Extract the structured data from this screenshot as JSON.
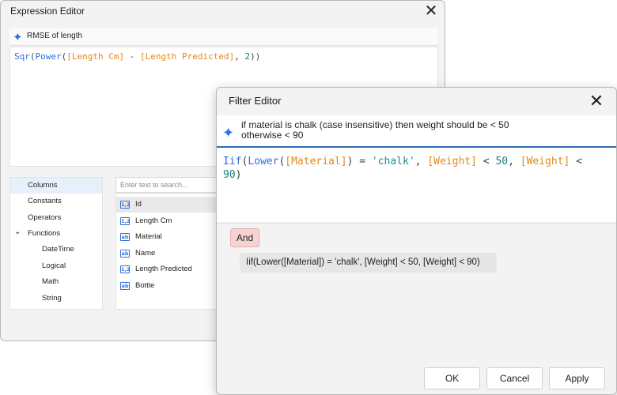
{
  "expression_editor": {
    "title": "Expression Editor",
    "close_glyph": "✕",
    "ai_prompt": "RMSE of length",
    "code": {
      "fn1": "Sqr",
      "fn2": "Power",
      "field1": "[Length Cm]",
      "minus": " - ",
      "field2": "[Length Predicted]",
      "comma": ", ",
      "num": "2",
      "open": "(",
      "close": "))"
    },
    "categories": [
      {
        "label": "Columns",
        "selected": true
      },
      {
        "label": "Constants"
      },
      {
        "label": "Operators"
      },
      {
        "label": "Functions",
        "expander": "⌄"
      },
      {
        "label": "DateTime"
      },
      {
        "label": "Logical"
      },
      {
        "label": "Math"
      },
      {
        "label": "String"
      }
    ],
    "search_placeholder": "Enter text to search...",
    "fields": [
      {
        "label": "Id",
        "icon": "1,2",
        "selected": true
      },
      {
        "label": "Length Cm",
        "icon": "1,2"
      },
      {
        "label": "Material",
        "icon": "ab"
      },
      {
        "label": "Name",
        "icon": "ab"
      },
      {
        "label": "Length Predicted",
        "icon": "1,2"
      },
      {
        "label": "Bottle",
        "icon": "ab"
      }
    ]
  },
  "filter_editor": {
    "title": "Filter Editor",
    "close_glyph": "✕",
    "ai_prompt": "if material is chalk (case insensitive) then weight should be < 50\notherwise < 90",
    "code": {
      "fn1": "Iif",
      "p1": "(",
      "fn2": "Lower",
      "p2": "(",
      "field1": "[Material]",
      "p3": ") = ",
      "str": "'chalk'",
      "c1": ", ",
      "field2": "[Weight]",
      "lt1": " < ",
      "n1": "50",
      "c2": ", ",
      "field3": "[Weight]",
      "lt2": " <",
      "n2": "90",
      "p4": ")"
    },
    "group_operator": "And",
    "condition": "Iif(Lower([Material]) = 'chalk', [Weight] < 50, [Weight] < 90)",
    "buttons": {
      "ok": "OK",
      "cancel": "Cancel",
      "apply": "Apply"
    }
  },
  "icons": {
    "ai": "sparkle-icon",
    "close": "close-icon",
    "expand": "chevron-down-icon"
  },
  "colors": {
    "accent": "#2f6fde",
    "field": "#e08a1a",
    "number": "#1a7f7a",
    "and_badge": "#f7d2d2"
  }
}
